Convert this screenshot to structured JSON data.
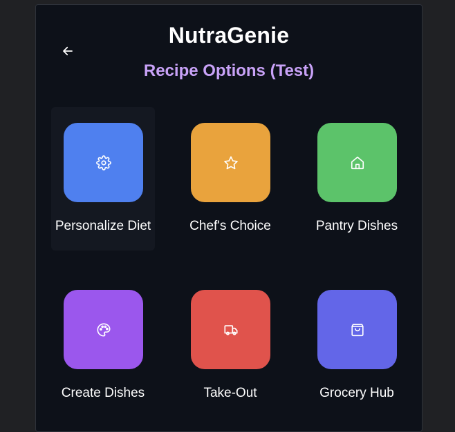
{
  "header": {
    "title": "NutraGenie",
    "subtitle": "Recipe Options (Test)"
  },
  "colors": {
    "page_background": "#202124",
    "panel_background": "#0d1119",
    "subtitle": "#c8a2f7"
  },
  "options": [
    {
      "label": "Personalize Diet",
      "icon": "gear-icon",
      "color": "#4f80ef",
      "active": true
    },
    {
      "label": "Chef's Choice",
      "icon": "star-icon",
      "color": "#e9a33d",
      "active": false
    },
    {
      "label": "Pantry Dishes",
      "icon": "home-icon",
      "color": "#5cc36a",
      "active": false
    },
    {
      "label": "Create Dishes",
      "icon": "palette-icon",
      "color": "#9b57ed",
      "active": false
    },
    {
      "label": "Take-Out",
      "icon": "truck-icon",
      "color": "#e0534c",
      "active": false
    },
    {
      "label": "Grocery Hub",
      "icon": "shopping-bag-icon",
      "color": "#6366e8",
      "active": false
    }
  ]
}
